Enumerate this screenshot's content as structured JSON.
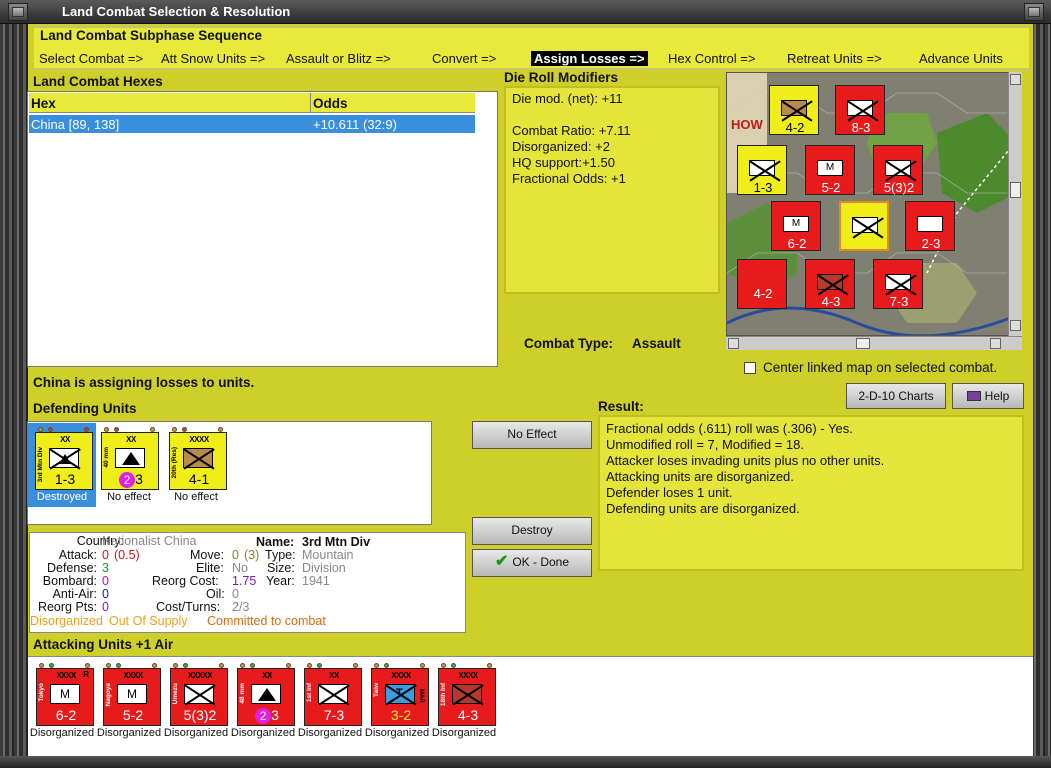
{
  "window": {
    "title": "Land Combat Selection & Resolution"
  },
  "subphase": {
    "title": "Land Combat Subphase Sequence",
    "steps": [
      "Select Combat =>",
      "Att Snow Units =>",
      "Assault or Blitz =>",
      "Convert =>",
      "Assign Losses =>",
      "Hex Control =>",
      "Retreat Units =>",
      "Advance Units"
    ],
    "active_step": "Assign Losses =>"
  },
  "hexes": {
    "title": "Land Combat Hexes",
    "columns": [
      "Hex",
      "Odds"
    ],
    "rows": [
      {
        "hex": "China [89, 138]",
        "odds": "+10.611 (32:9)"
      }
    ]
  },
  "modifiers": {
    "title": "Die Roll Modifiers",
    "lines": [
      "Die mod. (net): +11",
      "",
      "Combat Ratio: +7.11",
      "Disorganized: +2",
      "HQ support:+1.50",
      "Fractional Odds: +1"
    ]
  },
  "combat_type": {
    "label": "Combat Type:",
    "value": "Assault"
  },
  "center_map": {
    "label": "Center linked map on selected combat.",
    "checked": false
  },
  "status": "China is assigning losses to units.",
  "buttons": {
    "charts": "2-D-10 Charts",
    "help": "Help",
    "no_effect": "No Effect",
    "destroy": "Destroy",
    "ok": "OK - Done"
  },
  "defending": {
    "title": "Defending Units",
    "units": [
      {
        "size": "XX",
        "name": "3rd Mtn Div",
        "strength": "1-3",
        "status": "Destroyed",
        "selected": true
      },
      {
        "size": "XX",
        "name": "40 mm",
        "strength": "3",
        "badge": "2",
        "status": "No effect"
      },
      {
        "size": "XXXX",
        "name": "20th (Res)",
        "strength": "4-1",
        "status": "No effect"
      }
    ]
  },
  "result": {
    "title": "Result:",
    "lines": [
      "Fractional odds (.611) roll was (.306)  - Yes.",
      "Unmodified roll = 7, Modified = 18.",
      "Attacker loses invading units plus no other units.",
      "Attacking units are disorganized.",
      "Defender loses 1 unit.",
      "Defending units are disorganized."
    ]
  },
  "unit_info": {
    "country_label": "Country:",
    "country": "Nationalist China",
    "name_label": "Name:",
    "name": "3rd Mtn Div",
    "attack_label": "Attack:",
    "attack": "0",
    "attack_extra": "(0.5)",
    "move_label": "Move:",
    "move": "0",
    "move_extra": "(3)",
    "type_label": "Type:",
    "type": "Mountain",
    "defense_label": "Defense:",
    "defense": "3",
    "elite_label": "Elite:",
    "elite": "No",
    "size_label": "Size:",
    "size": "Division",
    "bombard_label": "Bombard:",
    "bombard": "0",
    "reorg_cost_label": "Reorg Cost:",
    "reorg_cost": "1.75",
    "year_label": "Year:",
    "year": "1941",
    "antiair_label": "Anti-Air:",
    "antiair": "0",
    "oil_label": "Oil:",
    "oil": "0",
    "reorg_pts_label": "Reorg Pts:",
    "reorg_pts": "0",
    "cost_turns_label": "Cost/Turns:",
    "cost_turns": "2/3",
    "status1": "Disorganized",
    "status2": "Out Of Supply",
    "status3": "Committed to combat"
  },
  "attacking": {
    "title": "Attacking Units +1 Air",
    "units": [
      {
        "size": "XXXX",
        "name": "Tokyo",
        "strength": "6-2",
        "status": "Disorganized",
        "r": "R",
        "sym": "M"
      },
      {
        "size": "XXXX",
        "name": "Nagoya",
        "strength": "5-2",
        "status": "Disorganized",
        "sym": "M"
      },
      {
        "size": "XXXXX",
        "name": "Umezu",
        "strength": "5(3)2",
        "status": "Disorganized",
        "sym": "X"
      },
      {
        "size": "XX",
        "name": "48 mm",
        "strength": "3",
        "badge": "2",
        "status": "Disorganized",
        "sym": "A"
      },
      {
        "size": "XX",
        "name": "1st Inf",
        "strength": "7-3",
        "status": "Disorganized",
        "sym": "X"
      },
      {
        "size": "XXXX",
        "name": "Taiw",
        "strength": "3-2",
        "status": "Disorganized",
        "sym": "T",
        "extra": "MAR"
      },
      {
        "size": "XXXX",
        "name": "18th Inf",
        "strength": "4-3",
        "status": "Disorganized",
        "sym": "X"
      }
    ]
  },
  "colors": {
    "panel": "#cfcf2a",
    "highlight": "#e9e93a",
    "axis": "#e71b1b",
    "allied": "#f0ee1a",
    "selection": "#3a8fdc"
  }
}
